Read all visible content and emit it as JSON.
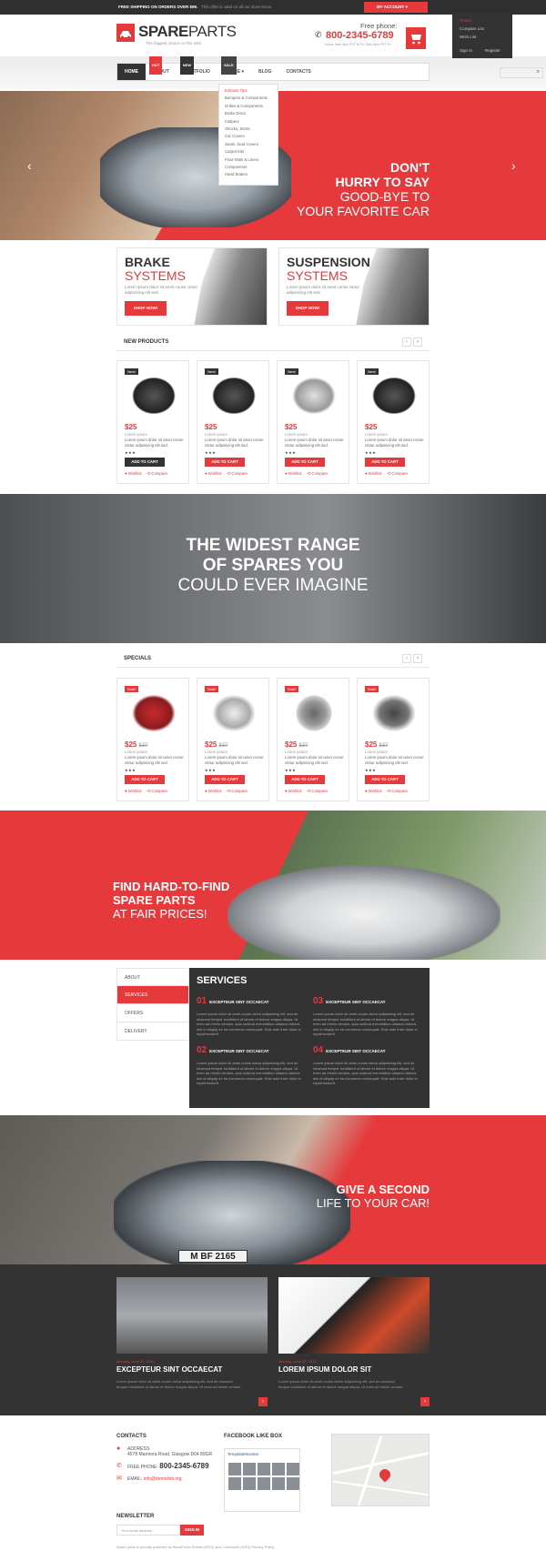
{
  "topbar": {
    "shipping": "FREE SHIPPING ON ORDERS OVER $99.",
    "shipping_note": "This offer is valid on all our store items.",
    "account": "MY ACCOUNT"
  },
  "account_menu": {
    "items": [
      "Orders",
      "Compare List",
      "Wish List"
    ],
    "sign_in": "Sign In",
    "register": "Register"
  },
  "header": {
    "logo_bold": "SPARE",
    "logo_light": "PARTS",
    "tagline": "The biggest choice on the web",
    "phone_label": "Free phone:",
    "phone": "800-2345-6789",
    "hours": "Hours: 9am-4pm PST M-Th; 9am-3pm PST Fri"
  },
  "nav": {
    "items": [
      "HOME",
      "ABOUT",
      "PORTFOLIO",
      "STORE",
      "BLOG",
      "CONTACTS"
    ],
    "badges": {
      "about": "HOT",
      "portfolio": "NEW",
      "store": "SALE"
    }
  },
  "dropdown": {
    "items": [
      "Exhaust Tips",
      "Bumpers & Components",
      "Grilles & Components",
      "Brake Discs",
      "Calipers",
      "Shocks, Struts",
      "Car Covers",
      "Seats, Seat Covers",
      "Carpet Kits",
      "Floor Mats & Liners",
      "Components",
      "Hand Brakes"
    ]
  },
  "hero": {
    "line1": "DON'T",
    "line2": "HURRY TO SAY",
    "line3": "GOOD-BYE TO",
    "line4": "YOUR FAVORITE CAR"
  },
  "promos": [
    {
      "title": "BRAKE",
      "subtitle": "SYSTEMS",
      "desc": "Lorem ipsum dolor sit amet conse ctetur adipisicing elit sed.",
      "button": "SHOP NOW!"
    },
    {
      "title": "SUSPENSION",
      "subtitle": "SYSTEMS",
      "desc": "Lorem ipsum dolor sit amet conse ctetur adipisicing elit sed.",
      "button": "SHOP NOW!"
    }
  ],
  "new_products": {
    "title": "NEW PRODUCTS",
    "items": [
      {
        "badge": "New!",
        "price": "$25",
        "name": "Lorem ipsum",
        "desc": "Lorem ipsum dolor sit amet conse ctetur adipisicing elit sed.",
        "stars": "★★★",
        "button": "ADD TO CART",
        "wishlist": "Wishlist",
        "compare": "Compare"
      },
      {
        "badge": "New!",
        "price": "$25",
        "name": "Lorem ipsum",
        "desc": "Lorem ipsum dolor sit amet conse ctetur adipisicing elit sed.",
        "stars": "★★★",
        "button": "ADD TO CART",
        "wishlist": "Wishlist",
        "compare": "Compare"
      },
      {
        "badge": "New!",
        "price": "$25",
        "name": "Lorem ipsum",
        "desc": "Lorem ipsum dolor sit amet conse ctetur adipisicing elit sed.",
        "stars": "★★★",
        "button": "ADD TO CART",
        "wishlist": "Wishlist",
        "compare": "Compare"
      },
      {
        "badge": "New!",
        "price": "$25",
        "name": "Lorem ipsum",
        "desc": "Lorem ipsum dolor sit amet conse ctetur adipisicing elit sed.",
        "stars": "★★★",
        "button": "ADD TO CART",
        "wishlist": "Wishlist",
        "compare": "Compare"
      }
    ]
  },
  "band1": {
    "line1": "THE WIDEST RANGE",
    "line2": "OF SPARES YOU",
    "line3": "COULD EVER IMAGINE"
  },
  "specials": {
    "title": "SPECIALS",
    "items": [
      {
        "badge": "Sale!",
        "price": "$25",
        "old_price": "$37",
        "name": "Lorem ipsum",
        "desc": "Lorem ipsum dolor sit amet conse ctetur adipisicing elit sed.",
        "stars": "★★★",
        "button": "ADD TO CART",
        "wishlist": "Wishlist",
        "compare": "Compare"
      },
      {
        "badge": "Sale!",
        "price": "$25",
        "old_price": "$37",
        "name": "Lorem ipsum",
        "desc": "Lorem ipsum dolor sit amet conse ctetur adipisicing elit sed.",
        "stars": "★★★",
        "button": "ADD TO CART",
        "wishlist": "Wishlist",
        "compare": "Compare"
      },
      {
        "badge": "Sale!",
        "price": "$25",
        "old_price": "$37",
        "name": "Lorem ipsum",
        "desc": "Lorem ipsum dolor sit amet conse ctetur adipisicing elit sed.",
        "stars": "★★★",
        "button": "ADD TO CART",
        "wishlist": "Wishlist",
        "compare": "Compare"
      },
      {
        "badge": "Sale!",
        "price": "$25",
        "old_price": "$37",
        "name": "Lorem ipsum",
        "desc": "Lorem ipsum dolor sit amet conse ctetur adipisicing elit sed.",
        "stars": "★★★",
        "button": "ADD TO CART",
        "wishlist": "Wishlist",
        "compare": "Compare"
      }
    ]
  },
  "band2": {
    "line1": "FIND HARD-TO-FIND",
    "line2": "SPARE PARTS",
    "line3": "AT FAIR PRICES!"
  },
  "tabs": [
    "ABOUT",
    "SERVICES",
    "OFFERS",
    "DELIVERY"
  ],
  "services": {
    "title": "SERVICES",
    "items": [
      {
        "num": "01",
        "title": "EXCEPTEUR SINT OCCAECAT",
        "text": "Lorem ipsum dolor sit amet conse ctetur adipisicing elit, sed do eiusmod tempor incididunt ut labore et dolore magna aliqua. Ut enim ad minim veniam, quis nostrud exercitation ullamco laboris nisi ut aliquip ex ea commodo consequat. Duis aute irure dolor in reprehenderit."
      },
      {
        "num": "03",
        "title": "EXCEPTEUR SINT OCCAECAT",
        "text": "Lorem ipsum dolor sit amet conse ctetur adipisicing elit, sed do eiusmod tempor incididunt ut labore et dolore magna aliqua. Ut enim ad minim veniam, quis nostrud exercitation ullamco laboris nisi ut aliquip ex ea commodo consequat. Duis aute irure dolor in reprehenderit."
      },
      {
        "num": "02",
        "title": "EXCEPTEUR SINT OCCAECAT",
        "text": "Lorem ipsum dolor sit amet conse ctetur adipisicing elit, sed do eiusmod tempor incididunt ut labore et dolore magna aliqua. Ut enim ad minim veniam, quis nostrud exercitation ullamco laboris nisi ut aliquip ex ea commodo consequat. Duis aute irure dolor in reprehenderit."
      },
      {
        "num": "04",
        "title": "EXCEPTEUR SINT OCCAECAT",
        "text": "Lorem ipsum dolor sit amet conse ctetur adipisicing elit, sed do eiusmod tempor incididunt ut labore et dolore magna aliqua. Ut enim ad minim veniam, quis nostrud exercitation ullamco laboris nisi ut aliquip ex ea commodo consequat. Duis aute irure dolor in reprehenderit."
      }
    ]
  },
  "band3": {
    "line1": "GIVE A SECOND",
    "line2": "LIFE TO YOUR CAR!",
    "plate": "M BF 2165"
  },
  "posts": [
    {
      "date": "Monday, June 22, 2015",
      "title": "EXCEPTEUR SINT OCCAECAT",
      "text": "Lorem ipsum dolor sit amet conse ctetur adipisicing elit, sed do eiusmod tempor incididunt ut labore et dolore magna aliqua. Ut enim ad minim veniam."
    },
    {
      "date": "Monday, June 22, 2015",
      "title": "LOREM IPSUM DOLOR SIT",
      "text": "Lorem ipsum dolor sit amet conse ctetur adipisicing elit, sed do eiusmod tempor incididunt ut labore et dolore magna aliqua. Ut enim ad minim veniam."
    }
  ],
  "footer": {
    "contacts_title": "CONTACTS",
    "address_label": "ADDRESS:",
    "address": "4578 Marmora Road, Glasgow D04 89GR",
    "phone_label": "FREE PHONE:",
    "phone": "800-2345-6789",
    "email_label": "EMAIL:",
    "email": "info@demolink.org",
    "newsletter_title": "NEWSLETTER",
    "newsletter_placeholder": "Your email address",
    "newsletter_button": "SIGN IN",
    "facebook_title": "FACEBOOK LIKE BOX",
    "facebook_page": "TemplateMonster",
    "copyright": "Spare parts is proudly powered by WordPress Entries (RSS) and Comments (RSS) Privacy Policy"
  }
}
